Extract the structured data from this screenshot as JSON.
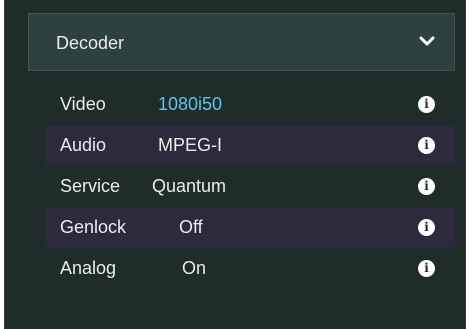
{
  "panel": {
    "title": "Decoder",
    "collapse_icon": "chevron-down-icon"
  },
  "rows": [
    {
      "label": "Video",
      "value": "1080i50",
      "value_color": "#5ec4e8",
      "icon": "info-icon"
    },
    {
      "label": "Audio",
      "value": "MPEG-I",
      "icon": "info-icon"
    },
    {
      "label": "Service",
      "value": "Quantum",
      "icon": "info-icon"
    },
    {
      "label": "Genlock",
      "value": "Off",
      "icon": "info-icon"
    },
    {
      "label": "Analog",
      "value": "On",
      "icon": "info-icon"
    }
  ],
  "info_glyph": "i",
  "colors": {
    "background": "#1e2c2a",
    "header": "#2d413e",
    "alt_row": "#2e2a3e",
    "text": "#e8ecec",
    "accent": "#5ec4e8"
  }
}
